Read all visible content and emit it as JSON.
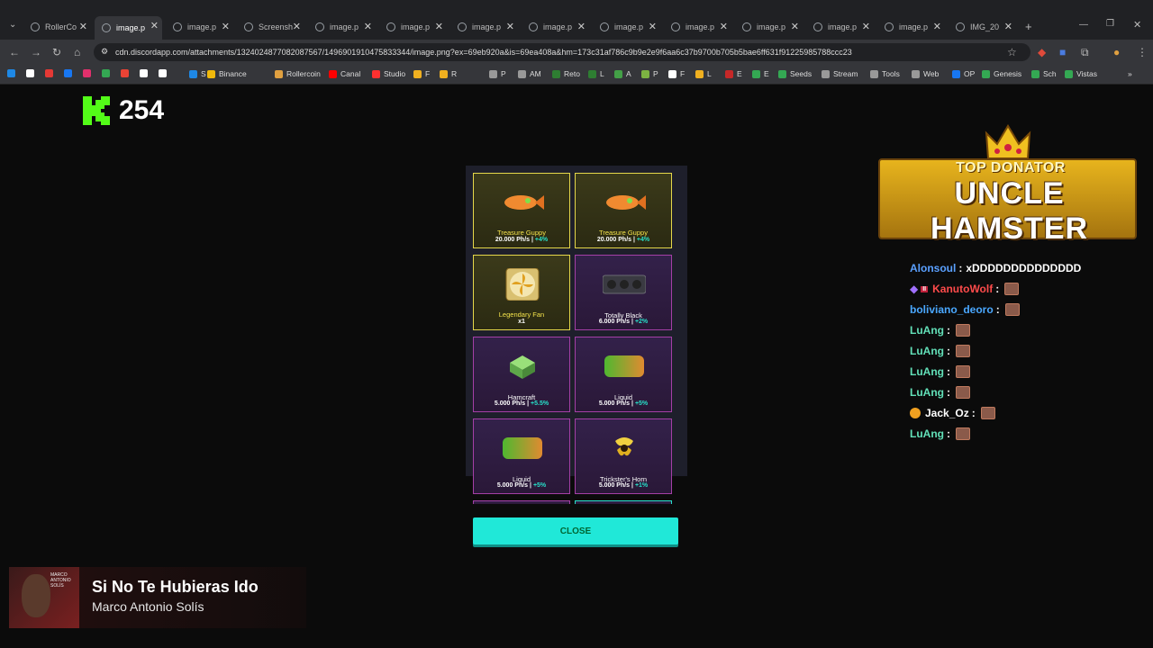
{
  "browser": {
    "tabs": [
      {
        "label": "RollerCo"
      },
      {
        "label": "image.p"
      },
      {
        "label": "image.p"
      },
      {
        "label": "Screensh"
      },
      {
        "label": "image.p"
      },
      {
        "label": "image.p"
      },
      {
        "label": "image.p"
      },
      {
        "label": "image.p"
      },
      {
        "label": "image.p"
      },
      {
        "label": "image.p"
      },
      {
        "label": "image.p"
      },
      {
        "label": "image.p"
      },
      {
        "label": "image.p"
      },
      {
        "label": "IMG_20"
      }
    ],
    "url": "cdn.discordapp.com/attachments/1324024877082087567/1496901910475833344/image.png?ex=69eb920a&is=69ea408a&hm=173c31af786c9b9e2e9f6aa6c37b9700b705b5bae6ff631f91225985788ccc23",
    "bookmarks": [
      {
        "label": "S"
      },
      {
        "label": "Binance"
      },
      {
        "label": "Rollercoin"
      },
      {
        "label": "Canal"
      },
      {
        "label": "Studio"
      },
      {
        "label": "F"
      },
      {
        "label": "R"
      },
      {
        "label": "P"
      },
      {
        "label": "AM"
      },
      {
        "label": "Reto"
      },
      {
        "label": "L"
      },
      {
        "label": "A"
      },
      {
        "label": "P"
      },
      {
        "label": "F"
      },
      {
        "label": "L"
      },
      {
        "label": "E"
      },
      {
        "label": "E"
      },
      {
        "label": "Seeds"
      },
      {
        "label": "Stream"
      },
      {
        "label": "Tools"
      },
      {
        "label": "Web"
      },
      {
        "label": "OP"
      },
      {
        "label": "Genesis"
      },
      {
        "label": "Sch"
      },
      {
        "label": "Vistas"
      }
    ]
  },
  "kick": {
    "viewers": "254",
    "brand_color": "#53fc18"
  },
  "loot": {
    "items": [
      {
        "name": "Treasure Guppy",
        "power": "20.000 Ph/s",
        "bonus": "+4%",
        "rarity": "gold",
        "icon": "fish-icon"
      },
      {
        "name": "Treasure Guppy",
        "power": "20.000 Ph/s",
        "bonus": "+4%",
        "rarity": "gold",
        "icon": "fish-icon"
      },
      {
        "name": "Legendary Fan",
        "power": "x1",
        "bonus": "",
        "rarity": "gold",
        "icon": "fan-icon"
      },
      {
        "name": "Totally Black",
        "power": "6.000 Ph/s",
        "bonus": "+2%",
        "rarity": "epic",
        "icon": "miner-icon"
      },
      {
        "name": "Hamcraft",
        "power": "5.000 Ph/s",
        "bonus": "+5.5%",
        "rarity": "epic",
        "icon": "cube-icon"
      },
      {
        "name": "Liquid",
        "power": "5.000 Ph/s",
        "bonus": "+5%",
        "rarity": "epic",
        "icon": "liquid-icon"
      },
      {
        "name": "Liquid",
        "power": "5.000 Ph/s",
        "bonus": "+5%",
        "rarity": "epic",
        "icon": "liquid-icon"
      },
      {
        "name": "Trickster's Horn",
        "power": "5.000 Ph/s",
        "bonus": "+1%",
        "rarity": "epic",
        "icon": "horn-icon"
      }
    ],
    "close_label": "CLOSE",
    "accent": "#20e8d8"
  },
  "donor": {
    "top_label": "TOP DONATOR",
    "name": "UNCLE HAMSTER"
  },
  "chat": [
    {
      "user": "Alonsoul",
      "color": "#5aa0ff",
      "message": "xDDDDDDDDDDDDDD",
      "emote": false
    },
    {
      "user": "KanutoWolf",
      "color": "#ff4b4b",
      "message": "",
      "emote": true
    },
    {
      "user": "boliviano_deoro",
      "color": "#4aa8ff",
      "message": "",
      "emote": true
    },
    {
      "user": "LuAng",
      "color": "#62e0b8",
      "message": "",
      "emote": true
    },
    {
      "user": "LuAng",
      "color": "#62e0b8",
      "message": "",
      "emote": true
    },
    {
      "user": "LuAng",
      "color": "#62e0b8",
      "message": "",
      "emote": true
    },
    {
      "user": "LuAng",
      "color": "#62e0b8",
      "message": "",
      "emote": true
    },
    {
      "user": "Jack_Oz",
      "color": "#ffffff",
      "message": "",
      "emote": true
    },
    {
      "user": "LuAng",
      "color": "#62e0b8",
      "message": "",
      "emote": true
    }
  ],
  "now_playing": {
    "title": "Si No Te Hubieras Ido",
    "artist": "Marco Antonio Solís",
    "cover_text": "MARCO ANTONIO SOLÍS"
  }
}
